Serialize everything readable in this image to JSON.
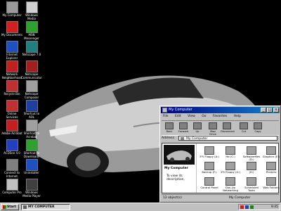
{
  "desktop_icons": [
    {
      "label": "My Computer",
      "color": "#9a9a9a"
    },
    {
      "label": "Windows Media",
      "color": "#d0d0d0"
    },
    {
      "label": "My Documents",
      "color": "#d02020"
    },
    {
      "label": "MSN Messenger",
      "color": "#30a030"
    },
    {
      "label": "Internet Explorer",
      "color": "#2050c0"
    },
    {
      "label": "Netscape 7.0",
      "color": "#208080"
    },
    {
      "label": "Network Neighborhood",
      "color": "#c02020"
    },
    {
      "label": "Netscape Communicator",
      "color": "#a02020"
    },
    {
      "label": "Recycle Bin",
      "color": "#c03030"
    },
    {
      "label": "Netscape Composer",
      "color": "#a0a0a0"
    },
    {
      "label": "Online Services",
      "color": "#c03030"
    },
    {
      "label": "Shortcut to AOL",
      "color": "#2040a0"
    },
    {
      "label": "Adobe Acrobat",
      "color": "#c02020"
    },
    {
      "label": "Shortcut to Acrobat",
      "color": "#a0a0a0"
    },
    {
      "label": "ACDSee 4.0",
      "color": "#2040c0"
    },
    {
      "label": "Shortcut to Downloads",
      "color": "#30a030"
    },
    {
      "label": "Connect to Internet",
      "color": "#808080"
    },
    {
      "label": "Uninstaller",
      "color": "#2050c0"
    },
    {
      "label": "Computer Pro",
      "color": "#c0c0c0"
    },
    {
      "label": "Windows Media Player",
      "color": "#404040"
    }
  ],
  "window": {
    "title": "My Computer",
    "menu": [
      "File",
      "Edit",
      "View",
      "Go",
      "Favorites",
      "Help"
    ],
    "toolbar": [
      "Back",
      "Forward",
      "Up",
      "Map Drive",
      "Disconnect",
      "Cut",
      "Copy"
    ],
    "address_label": "Address",
    "address_value": "My Computer",
    "pane_title": "My Computer",
    "pane_desc": "To view its description,",
    "items": [
      "3½ Floppy (A:)",
      "Hd (C:)",
      "Softwarefiles (D:)",
      "Graphics (E:)",
      "Backup (F:)",
      "3½ Floppy (G:)",
      "(H:)",
      "Printers",
      "Control Panel",
      "Dial-Up Networking",
      "Scheduled Tasks",
      "Web Folders"
    ],
    "status_count": "12 object(s)",
    "status_right": "My Computer"
  },
  "taskbar": {
    "start_label": "Start",
    "task_label": "MY COMPUTER",
    "clock": "9:45"
  },
  "colors": {
    "titlebar": "#000080",
    "face": "#c0c0c0"
  }
}
